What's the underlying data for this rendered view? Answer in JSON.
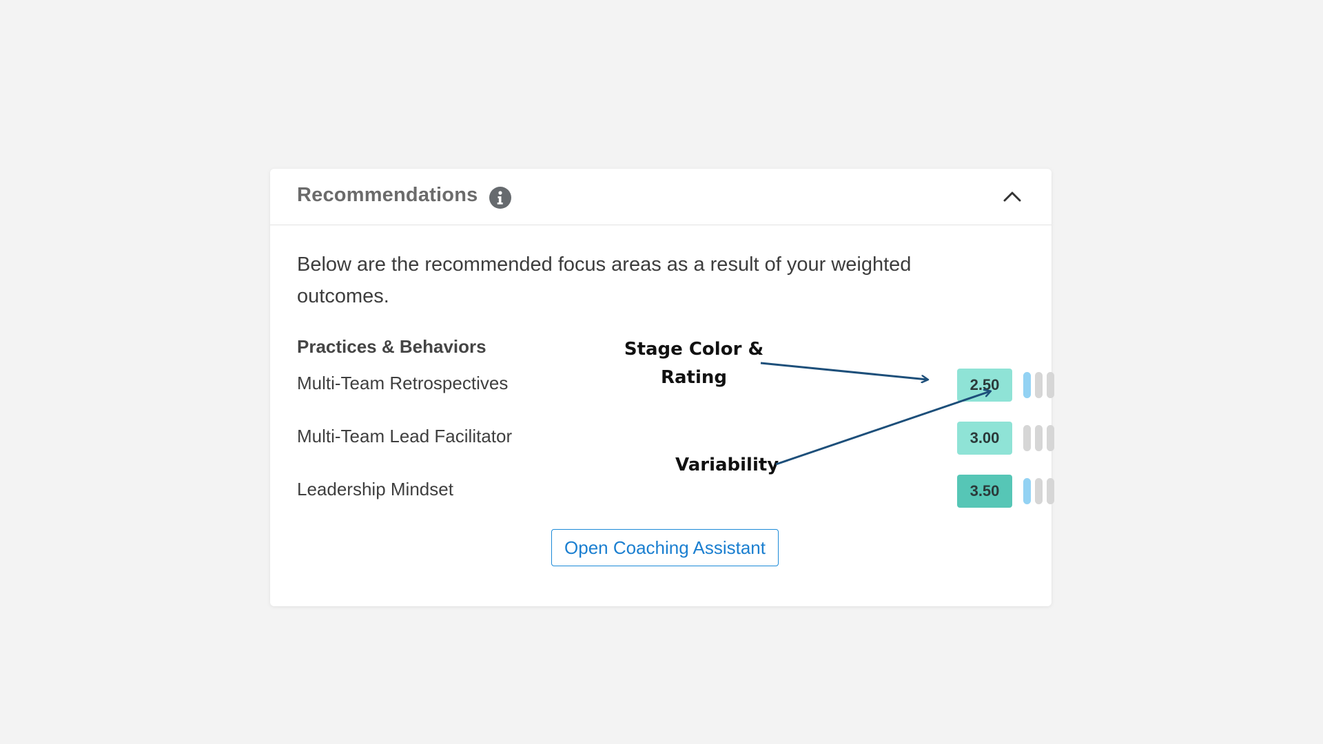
{
  "card": {
    "title": "Recommendations",
    "info_icon": "info-icon",
    "collapse_icon": "chevron-up-icon",
    "intro_text": "Below are the recommended focus areas as a result of your weighted outcomes.",
    "section_heading": "Practices & Behaviors",
    "items": [
      {
        "label": "Multi-Team Retrospectives",
        "rating": "2.50",
        "stage_color": "#8fe3d6",
        "variability_level": 1
      },
      {
        "label": "Multi-Team Lead Facilitator",
        "rating": "3.00",
        "stage_color": "#8fe3d6",
        "variability_level": 0
      },
      {
        "label": "Leadership Mindset",
        "rating": "3.50",
        "stage_color": "#56c6b6",
        "variability_level": 1
      }
    ],
    "coach_button_label": "Open Coaching Assistant"
  },
  "colors": {
    "variability_active": "#93d2f3",
    "variability_inactive": "#d6d6d6",
    "button_accent": "#1b8ad8",
    "annotation_arrow": "#1d4f7a"
  },
  "annotations": {
    "stage_color_line1": "Stage Color &",
    "stage_color_line2": "Rating",
    "variability": "Variability"
  }
}
